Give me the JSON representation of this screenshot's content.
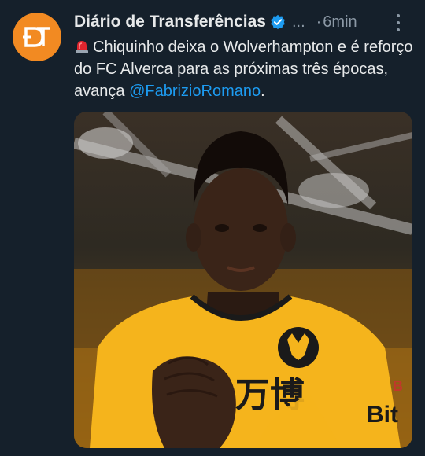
{
  "tweet": {
    "author_name": "Diário de Transferências",
    "handle": "...",
    "separator": "·",
    "time": "6min",
    "text_before": "Chiquinho deixa o Wolverhampton e é reforço do FC Alverca para as próximas três épocas, avança ",
    "mention": "@FabrizioRomano",
    "text_after": "."
  },
  "media": {
    "shirt_sponsor": "Bit",
    "chest_text": "万博",
    "sleeve_letter": "B"
  },
  "colors": {
    "background": "#15202b",
    "accent": "#1d9bf0",
    "avatar": "#f28a22",
    "muted": "#8b98a5"
  }
}
